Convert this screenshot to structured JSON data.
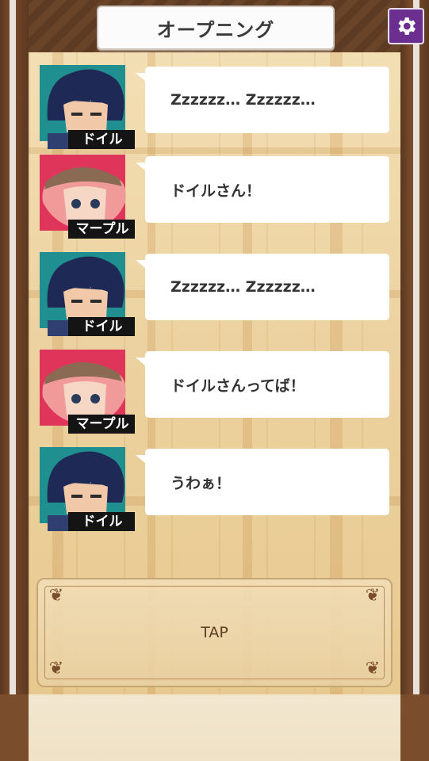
{
  "header": {
    "title": "オープニング",
    "settings_icon": "gear-icon"
  },
  "colors": {
    "settings_button": "#6b2f8f",
    "wood": "#6b4328",
    "name_tag": "#141414"
  },
  "messages": [
    {
      "speaker": "ドイル",
      "text": "Zzzzzz… Zzzzzz…",
      "avatar": "doyle-avatar"
    },
    {
      "speaker": "マープル",
      "text": "ドイルさん！",
      "avatar": "marple-avatar"
    },
    {
      "speaker": "ドイル",
      "text": "Zzzzzz… Zzzzzz…",
      "avatar": "doyle-avatar"
    },
    {
      "speaker": "マープル",
      "text": "ドイルさんってば！",
      "avatar": "marple-avatar"
    },
    {
      "speaker": "ドイル",
      "text": "うわぁ！",
      "avatar": "doyle-avatar"
    }
  ],
  "tap_panel": {
    "label": "TAP"
  }
}
